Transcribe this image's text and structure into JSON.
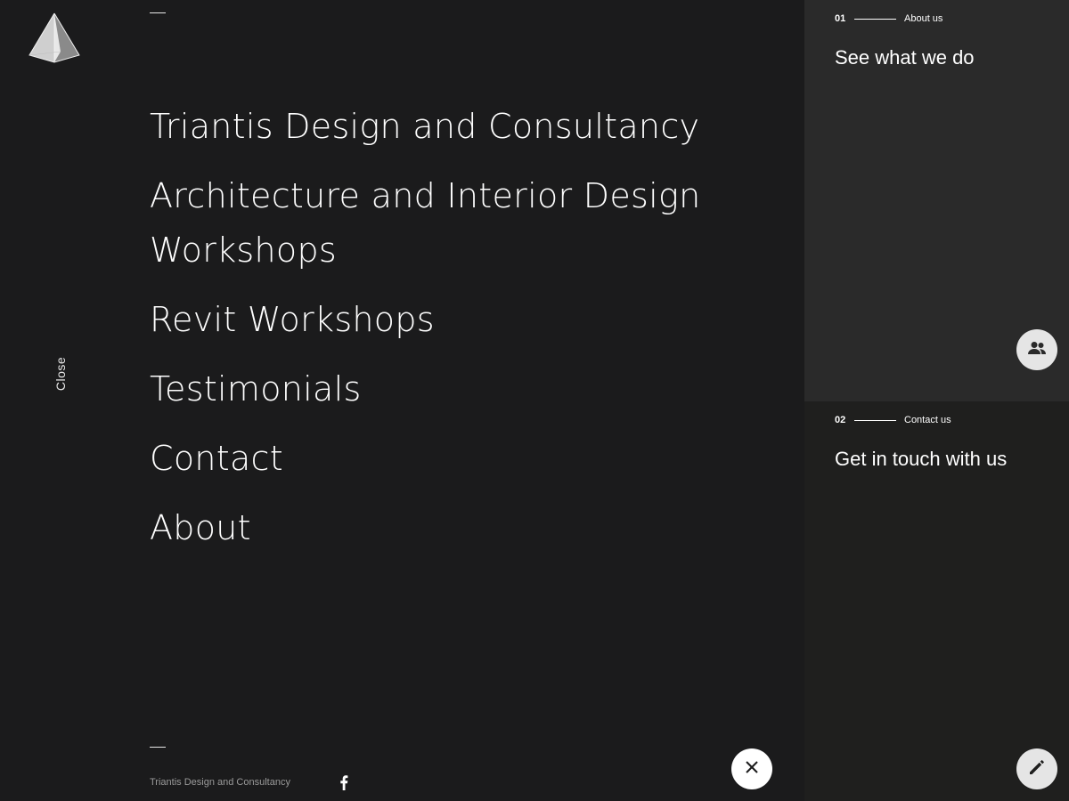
{
  "brand": {
    "logo_icon": "pyramid-logo-icon",
    "footer_name": "Triantis Design and Consultancy"
  },
  "sidebar": {
    "close_label": "Close"
  },
  "menu": {
    "items": [
      {
        "label": "Triantis Design and Consultancy"
      },
      {
        "label": "Architecture and Interior Design Workshops"
      },
      {
        "label": "Revit Workshops"
      },
      {
        "label": "Testimonials"
      },
      {
        "label": "Contact"
      },
      {
        "label": "About"
      }
    ]
  },
  "footer": {
    "social_icon": "facebook-icon",
    "close_icon": "close-icon"
  },
  "panels": {
    "about": {
      "number": "01",
      "eyebrow": "About us",
      "heading": "See what we do",
      "icon": "people-icon"
    },
    "contact": {
      "number": "02",
      "eyebrow": "Contact us",
      "heading": "Get in touch with us",
      "icon": "pencil-icon"
    }
  },
  "colors": {
    "background": "#1b1b1c",
    "panel_about": "#2a2a2a",
    "panel_contact": "#1f1f1e",
    "text": "#ffffff",
    "button": "#e5e5e5"
  }
}
